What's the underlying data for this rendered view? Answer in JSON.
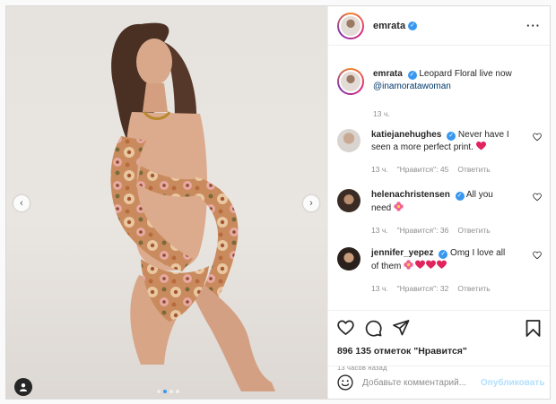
{
  "post": {
    "author": "emrata",
    "caption": {
      "username": "emrata",
      "text": "Leopard Floral live now",
      "mention": "@inamoratawoman",
      "time": "13 ч."
    },
    "comments": [
      {
        "username": "katiejanehughes",
        "text": "Never have I seen a more perfect print.",
        "emoji": "red-heart-emoji",
        "time": "13 ч.",
        "likes": "\"Нравится\": 45",
        "reply": "Ответить"
      },
      {
        "username": "helenachristensen",
        "text": "All you need",
        "emoji": "flower-emoji",
        "time": "13 ч.",
        "likes": "\"Нравится\": 36",
        "reply": "Ответить"
      },
      {
        "username": "jennifer_yepez",
        "text": "Omg I love all of them",
        "emoji": "flower-and-hearts-emoji",
        "time": "13 ч.",
        "likes": "\"Нравится\": 32",
        "reply": "Ответить"
      }
    ],
    "likes_text": "896 135 отметок \"Нравится\"",
    "posted_ago": "13 часов назад",
    "comment_placeholder": "Добавьте комментарий...",
    "publish_label": "Опубликовать",
    "carousel": {
      "slides": 4,
      "active_index": 1
    }
  },
  "colors": {
    "link": "#00376b",
    "verified": "#3897f0",
    "publish_disabled": "#b2dffc",
    "muted": "#8e8e8e"
  }
}
